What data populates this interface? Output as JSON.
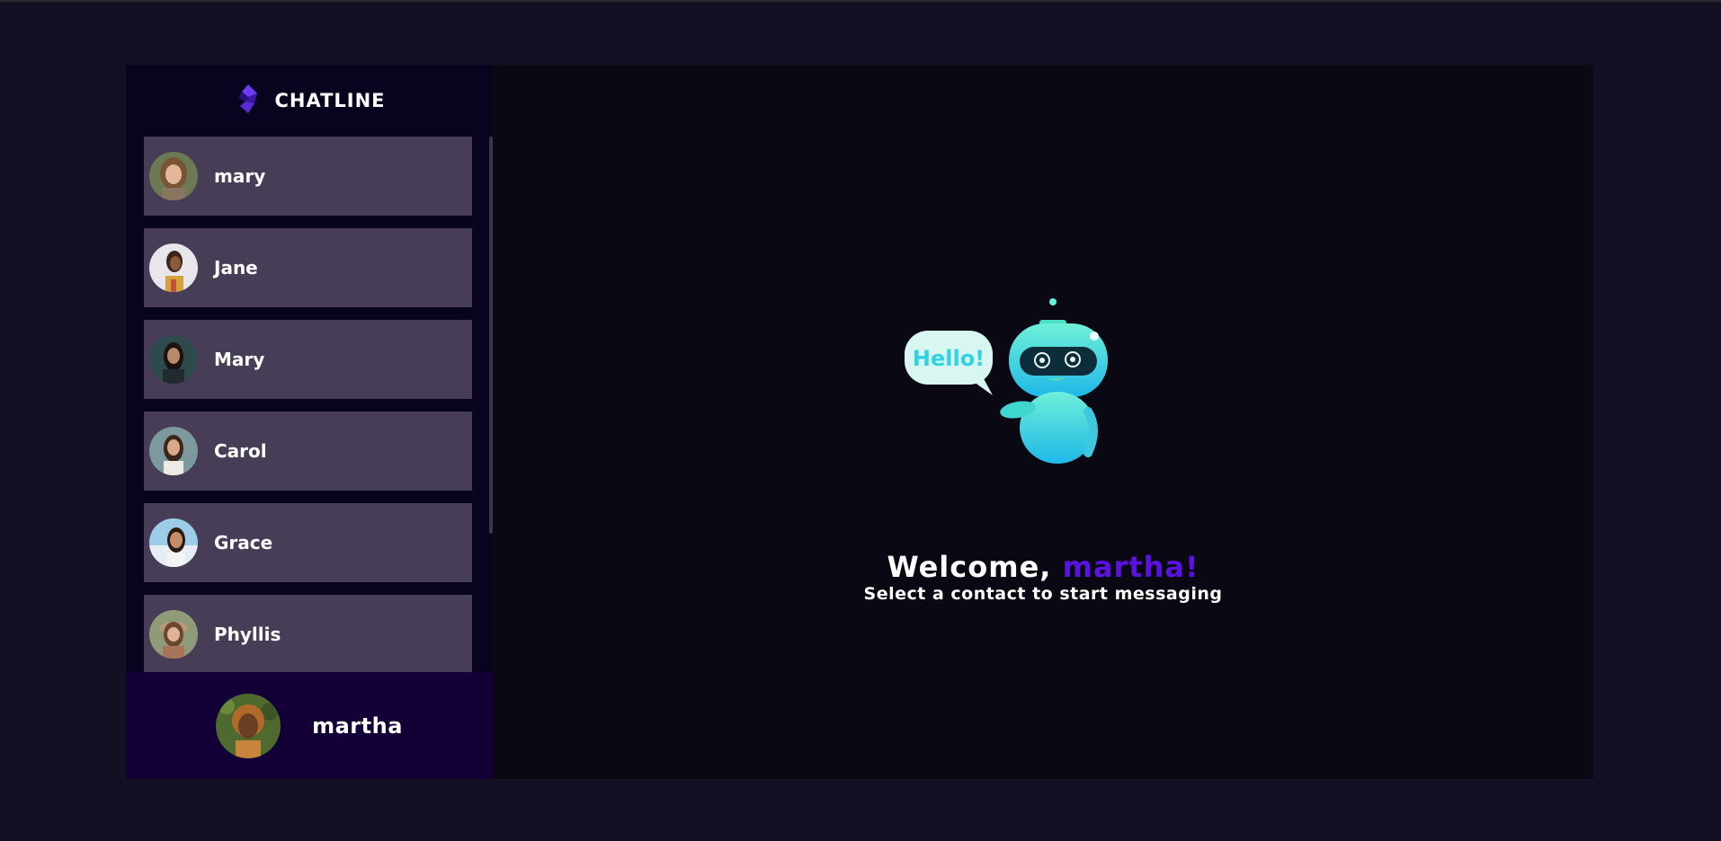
{
  "brand": {
    "name": "CHATLINE",
    "logo_icon": "chatline-logo-icon",
    "color": "#5b2bd9"
  },
  "contacts": [
    {
      "name": "mary",
      "avatar": "avatar-mary"
    },
    {
      "name": "Jane",
      "avatar": "avatar-jane"
    },
    {
      "name": "Mary",
      "avatar": "avatar-mary-2"
    },
    {
      "name": "Carol",
      "avatar": "avatar-carol"
    },
    {
      "name": "Grace",
      "avatar": "avatar-grace"
    },
    {
      "name": "Phyllis",
      "avatar": "avatar-phyllis"
    }
  ],
  "current_user": {
    "name": "martha"
  },
  "welcome": {
    "greeting": "Welcome,",
    "username": "martha!",
    "subtitle": "Select a contact to start messaging",
    "bubble_text": "Hello!",
    "accent": "#5a12e0"
  },
  "colors": {
    "page_bg": "#131023",
    "sidebar_bg": "#080420",
    "contact_bg": "#473d57",
    "user_panel_bg": "#120036",
    "main_bg": "#0a0812"
  }
}
